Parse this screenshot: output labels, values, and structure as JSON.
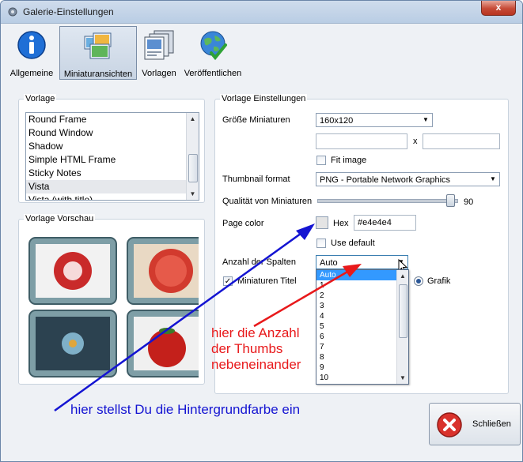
{
  "window": {
    "title": "Galerie-Einstellungen",
    "close_glyph": "x"
  },
  "toolbar": {
    "items": [
      {
        "label": "Allgemeine",
        "icon": "info-icon"
      },
      {
        "label": "Miniaturansichten",
        "icon": "thumbnails-icon",
        "active": true
      },
      {
        "label": "Vorlagen",
        "icon": "templates-icon"
      },
      {
        "label": "Veröffentlichen",
        "icon": "globe-publish-icon"
      }
    ]
  },
  "vorlage": {
    "title": "Vorlage",
    "items": [
      "Round Frame",
      "Round Window",
      "Shadow",
      "Simple HTML Frame",
      "Sticky Notes",
      "Vista",
      "Vista (with title)"
    ],
    "selected": "Vista"
  },
  "preview": {
    "title": "Vorlage Vorschau"
  },
  "settings": {
    "title": "Vorlage Einstellungen",
    "size_label": "Größe Miniaturen",
    "size_value": "160x120",
    "x_label": "x",
    "fit_image_label": "Fit image",
    "format_label": "Thumbnail format",
    "format_value": "PNG - Portable Network Graphics",
    "quality_label": "Qualität von Miniaturen",
    "quality_value": "90",
    "page_color_label": "Page color",
    "hex_label": "Hex",
    "hex_value": "#e4e4e4",
    "use_default_label": "Use default",
    "columns_label": "Anzahl der Spalten",
    "columns_value": "Auto",
    "titles_label": "Miniaturen Titel",
    "grafik_label": "Grafik"
  },
  "dropdown": {
    "options": [
      "Auto",
      "1",
      "2",
      "3",
      "4",
      "5",
      "6",
      "7",
      "8",
      "9",
      "10"
    ],
    "selected": "Auto"
  },
  "annotations": {
    "red_lines": [
      "hier die Anzahl",
      "der Thumbs",
      "nebeneinander"
    ],
    "blue_text": "hier stellst Du die Hintergrundfarbe ein",
    "red_color": "#e8191b",
    "blue_color": "#1414d2"
  },
  "close_button": {
    "label": "Schließen"
  }
}
